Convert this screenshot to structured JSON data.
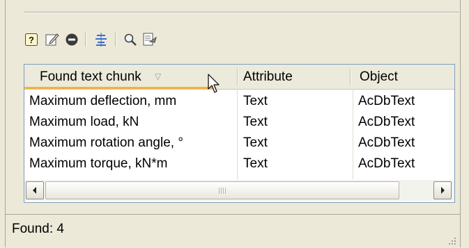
{
  "toolbar": {
    "buttons": [
      {
        "name": "help-icon",
        "glyph": "?"
      },
      {
        "name": "edit-icon",
        "glyph": "✎"
      },
      {
        "name": "remove-icon",
        "glyph": "−"
      },
      {
        "name": "align-icon",
        "glyph": "≡"
      },
      {
        "name": "search-icon",
        "glyph": "🔍"
      },
      {
        "name": "export-icon",
        "glyph": "⇒"
      }
    ]
  },
  "grid": {
    "columns": [
      {
        "label": "Found text chunk",
        "sort_indicator": "▽"
      },
      {
        "label": "Attribute"
      },
      {
        "label": "Object"
      }
    ],
    "rows": [
      {
        "chunk": "Maximum deflection, mm",
        "attribute": "Text",
        "object": "AcDbText"
      },
      {
        "chunk": "Maximum load, kN",
        "attribute": "Text",
        "object": "AcDbText"
      },
      {
        "chunk": "Maximum rotation angle, °",
        "attribute": "Text",
        "object": "AcDbText"
      },
      {
        "chunk": "Maximum torque, kN*m",
        "attribute": "Text",
        "object": "AcDbText"
      }
    ]
  },
  "status": {
    "text": "Found: 4"
  },
  "colors": {
    "sort_accent": "#f5b23b",
    "grid_border": "#7f9db9",
    "panel_bg": "#ece9d8"
  }
}
